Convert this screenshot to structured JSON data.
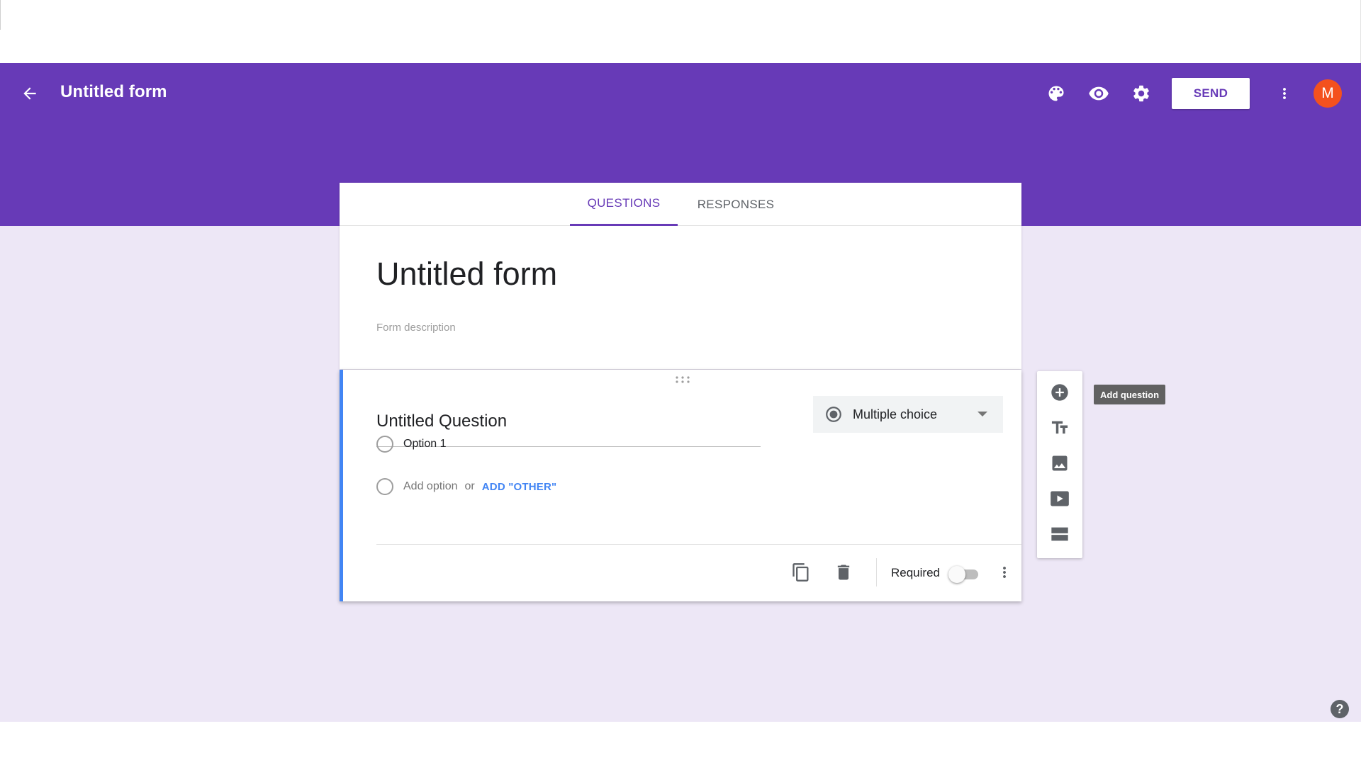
{
  "header": {
    "title": "Untitled form",
    "send_label": "SEND",
    "avatar_initial": "M",
    "colors": {
      "brand": "#673ab7",
      "avatar": "#f4511e"
    }
  },
  "tabs": [
    {
      "label": "QUESTIONS",
      "active": true
    },
    {
      "label": "RESPONSES",
      "active": false
    }
  ],
  "form": {
    "title": "Untitled form",
    "description_placeholder": "Form description"
  },
  "question": {
    "title": "Untitled Question",
    "type_label": "Multiple choice",
    "options": [
      "Option 1"
    ],
    "add_option": "Add option",
    "or_text": "or",
    "add_other": "ADD \"OTHER\"",
    "required_label": "Required",
    "required": false
  },
  "toolbar": {
    "tooltip": "Add question",
    "icons": [
      "add-circle-icon",
      "title-icon",
      "image-icon",
      "video-icon",
      "section-icon"
    ]
  },
  "help_icon": "?",
  "colors": {
    "canvas": "#ede7f6",
    "accent_blue": "#4285f4"
  }
}
